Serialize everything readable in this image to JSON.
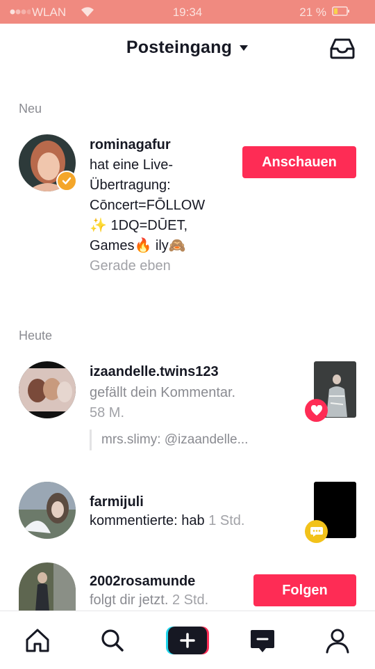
{
  "status_bar": {
    "carrier": "WLAN",
    "time": "19:34",
    "battery_percent": "21 %"
  },
  "header": {
    "title": "Posteingang",
    "caret_icon": "caret-down-icon",
    "inbox_icon": "inbox-tray-icon"
  },
  "sections": {
    "new_label": "Neu",
    "today_label": "Heute"
  },
  "notifications": [
    {
      "username": "rominagafur",
      "message_lines": [
        "hat eine Live-",
        "Übertragung:",
        "Cōncert=FŌLLOW",
        "✨ 1DQ=DŪET,",
        "Games🔥 ily🙈"
      ],
      "time": "Gerade eben",
      "action_label": "Anschauen",
      "verified": true
    },
    {
      "username": "izaandelle.twins123",
      "message": "gefällt dein Kommentar.",
      "time": "58 M.",
      "quote": "mrs.slimy: @izaandelle...",
      "badge_icon": "heart-icon",
      "badge_color": "#fe2c55"
    },
    {
      "username": "farmijuli",
      "message": "kommentierte: hab",
      "time": "1 Std.",
      "badge_icon": "comment-icon",
      "badge_color": "#f2c21a"
    },
    {
      "username": "2002rosamunde",
      "message": "folgt dir jetzt.",
      "time": "2 Std.",
      "action_label": "Folgen"
    }
  ],
  "bottom_nav": {
    "items": [
      "home-icon",
      "search-icon",
      "create-plus-icon",
      "inbox-message-icon",
      "profile-icon"
    ]
  },
  "colors": {
    "accent": "#fe2c55",
    "status_bar": "#f08a80",
    "verified": "#f4a62a",
    "comment_badge": "#f2c21a"
  }
}
